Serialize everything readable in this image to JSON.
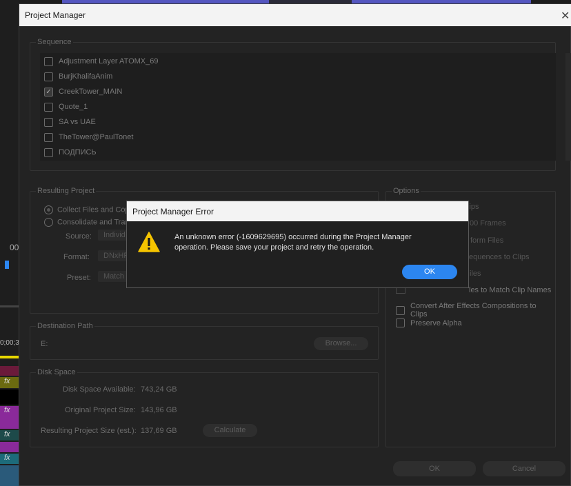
{
  "window": {
    "title": "Project Manager",
    "close_glyph": "✕"
  },
  "sequence": {
    "legend": "Sequence",
    "items": [
      {
        "label": "Adjustment Layer ATOMX_69",
        "checked": false
      },
      {
        "label": "BurjKhalifaAnim",
        "checked": false
      },
      {
        "label": "CreekTower_MAIN",
        "checked": true
      },
      {
        "label": "Quote_1",
        "checked": false
      },
      {
        "label": "SA vs UAE",
        "checked": false
      },
      {
        "label": "TheTower@PaulTonet",
        "checked": false
      },
      {
        "label": "ПОДПИСЬ",
        "checked": false
      }
    ]
  },
  "resulting_project": {
    "legend": "Resulting Project",
    "collect_label": "Collect Files and Cop",
    "consolidate_label": "Consolidate and Tran",
    "source_label": "Source:",
    "source_value": "Individ",
    "format_label": "Format:",
    "format_value": "DNxHR",
    "preset_label": "Preset:",
    "preset_value": "Match"
  },
  "options": {
    "legend": "Options",
    "items": [
      "Exclude Unused Clips",
      "Include Handles 30 Frames",
      "Include Conform Files",
      "Render Sequences to Clips",
      "Rename Files",
      "Rename Files to Match Clip Names",
      "Convert After Effects Compositions to Clips",
      "Preserve Alpha"
    ],
    "fragments": [
      "lips",
      "00 Frames",
      "form Files",
      "equences to Clips",
      "iles",
      "les to Match Clip Names"
    ]
  },
  "destination": {
    "legend": "Destination Path",
    "path": "E:",
    "browse_label": "Browse..."
  },
  "disk_space": {
    "legend": "Disk Space",
    "available_label": "Disk Space Available:",
    "available_value": "743,24 GB",
    "original_label": "Original Project Size:",
    "original_value": "143,96 GB",
    "resulting_label": "Resulting Project Size (est.):",
    "resulting_value": "137,69 GB",
    "calculate_label": "Calculate"
  },
  "footer": {
    "ok_label": "OK",
    "cancel_label": "Cancel"
  },
  "error_dialog": {
    "title": "Project Manager Error",
    "message_line1": "An unknown error (-1609629695) occurred during the Project Manager",
    "message_line2": "operation. Please save your project and retry the operation.",
    "ok_label": "OK",
    "icon": "warning-icon"
  },
  "background": {
    "timecode_fragment": "00",
    "timecode_fragment2": "0;00;3",
    "clip_glyph": "fx"
  },
  "colors": {
    "accent": "#2c86f0",
    "warning": "#f5c400",
    "purple_clip": "#8a2a9a",
    "teal_clip": "#1d6b7a",
    "olive_clip": "#6b6a10"
  }
}
